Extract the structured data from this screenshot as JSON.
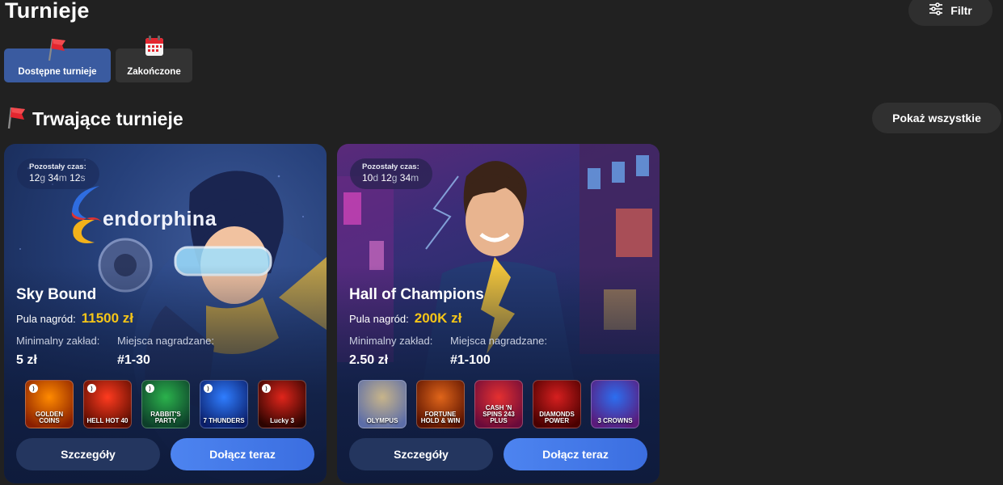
{
  "header": {
    "title": "Turnieje",
    "filter_label": "Filtr"
  },
  "tabs": [
    {
      "label": "Dostępne turnieje",
      "icon": "red-flag-icon",
      "active": true
    },
    {
      "label": "Zakończone",
      "icon": "calendar-icon",
      "active": false
    }
  ],
  "section": {
    "title": "Trwające turnieje",
    "icon": "red-flag-icon",
    "show_all_label": "Pokaż wszystkie"
  },
  "tournaments": [
    {
      "timer_caption": "Pozostały czas:",
      "timer": [
        {
          "n": "12",
          "u": "g"
        },
        {
          "n": "34",
          "u": "m"
        },
        {
          "n": "12",
          "u": "s"
        }
      ],
      "provider_logo": "endorphina",
      "title": "Sky Bound",
      "prize_label": "Pula nagród:",
      "prize_value": "11500 zł",
      "min_bet_label": "Minimalny zakład:",
      "min_bet_value": "5 zł",
      "places_label": "Miejsca nagradzane:",
      "places_value": "#1-30",
      "games": [
        {
          "name": "GOLDEN COINS",
          "colors": [
            "#ff8a00",
            "#8a1f00"
          ]
        },
        {
          "name": "HELL HOT 40",
          "colors": [
            "#ff3b1f",
            "#5a0c00"
          ]
        },
        {
          "name": "RABBIT'S PARTY",
          "colors": [
            "#2bb24c",
            "#0d3f2a"
          ]
        },
        {
          "name": "7 THUNDERS",
          "colors": [
            "#2f7dff",
            "#0b1f6b"
          ]
        },
        {
          "name": "Lucky 3",
          "colors": [
            "#e0251b",
            "#2c0400"
          ]
        }
      ],
      "details_label": "Szczegóły",
      "join_label": "Dołącz teraz"
    },
    {
      "timer_caption": "Pozostały czas:",
      "timer": [
        {
          "n": "10",
          "u": "d"
        },
        {
          "n": "12",
          "u": "g"
        },
        {
          "n": "34",
          "u": "m"
        }
      ],
      "title": "Hall of Champions",
      "prize_label": "Pula nagród:",
      "prize_value": "200K zł",
      "min_bet_label": "Minimalny zakład:",
      "min_bet_value": "2.50 zł",
      "places_label": "Miejsca nagradzane:",
      "places_value": "#1-100",
      "games": [
        {
          "name": "OLYMPUS",
          "colors": [
            "#c7b48a",
            "#5c6da8"
          ]
        },
        {
          "name": "FORTUNE HOLD & WIN",
          "colors": [
            "#e0651a",
            "#5a1200"
          ]
        },
        {
          "name": "CASH 'N SPINS 243 PLUS",
          "colors": [
            "#e53030",
            "#6a0a3a"
          ]
        },
        {
          "name": "DIAMONDS POWER",
          "colors": [
            "#d61f1f",
            "#4a0000"
          ]
        },
        {
          "name": "3 CROWNS",
          "colors": [
            "#2c6ef0",
            "#5a1a7a"
          ]
        }
      ],
      "details_label": "Szczegóły",
      "join_label": "Dołącz teraz"
    }
  ]
}
